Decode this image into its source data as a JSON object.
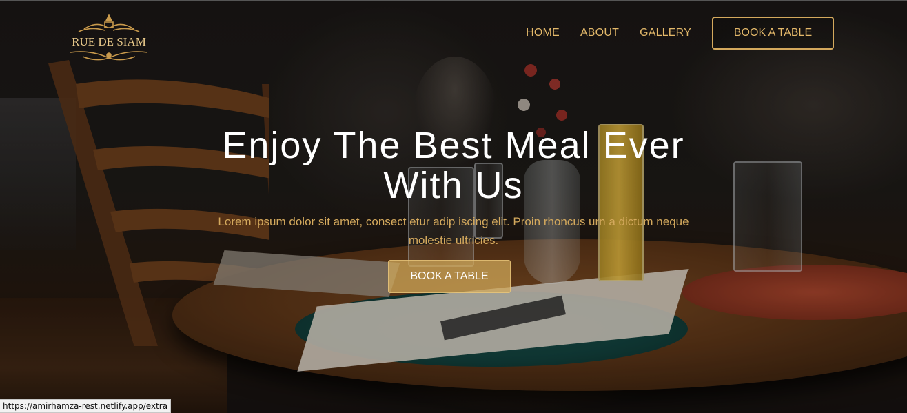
{
  "brand": {
    "logo_text": "RUE DE SIAM",
    "logo_icon": "ornamental-crest-icon",
    "gold_color": "#d4a95d"
  },
  "nav": {
    "items": [
      {
        "label": "HOME"
      },
      {
        "label": "ABOUT"
      },
      {
        "label": "GALLERY"
      }
    ],
    "cta_label": "BOOK A TABLE"
  },
  "hero": {
    "title_line1": "Enjoy The Best Meal Ever",
    "title_line2": "With Us",
    "subtitle": "Lorem ipsum dolor sit amet, consect etur adip iscing elit. Proin rhoncus urn a dictum neque molestie ultricies.",
    "button_label": "BOOK A TABLE"
  },
  "status_bar": {
    "url": "https://amirhamza-rest.netlify.app/extra"
  }
}
